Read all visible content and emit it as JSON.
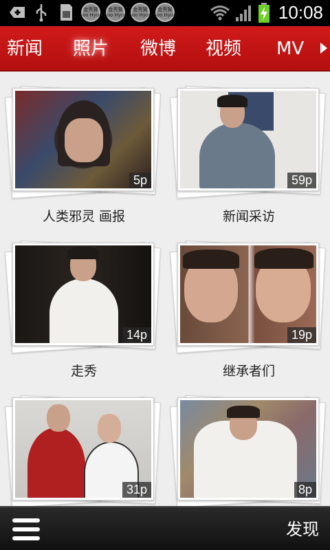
{
  "statusbar": {
    "time": "10:08",
    "coin_text": "金秀賢\nSoo Hyun",
    "icons": [
      "add-icon",
      "usb-icon",
      "sdcard-icon",
      "wifi-icon",
      "signal-icon",
      "battery-charging-icon"
    ]
  },
  "tabs": [
    {
      "label": "新闻",
      "active": false
    },
    {
      "label": "照片",
      "active": true
    },
    {
      "label": "微博",
      "active": false
    },
    {
      "label": "视频",
      "active": false
    },
    {
      "label": "MV",
      "active": false
    }
  ],
  "albums": [
    {
      "title": "人类邪灵 画报",
      "count": "5p"
    },
    {
      "title": "新闻采访",
      "count": "59p"
    },
    {
      "title": "走秀",
      "count": "14p"
    },
    {
      "title": "继承者们",
      "count": "19p"
    },
    {
      "title": "",
      "count": "31p"
    },
    {
      "title": "",
      "count": "8p"
    }
  ],
  "bottombar": {
    "discover_label": "发现"
  },
  "colors": {
    "tabbar": "#c01414",
    "bottombar": "#1a1a1a"
  }
}
